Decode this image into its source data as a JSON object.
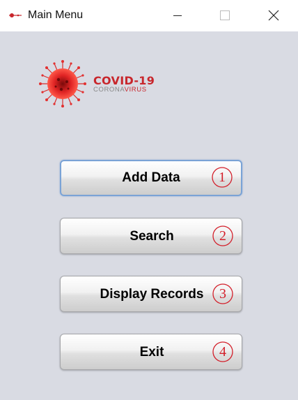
{
  "window": {
    "title": "Main Menu",
    "controls": {
      "minimize": "minimize-icon",
      "maximize": "maximize-icon",
      "close": "close-icon"
    }
  },
  "logo": {
    "title": "COVID-19",
    "subtitle_part1": "CORONA",
    "subtitle_part2": "VIRUS",
    "icon": "coronavirus-icon"
  },
  "menu": {
    "buttons": [
      {
        "label": "Add Data",
        "number": "1"
      },
      {
        "label": "Search",
        "number": "2"
      },
      {
        "label": "Display Records",
        "number": "3"
      },
      {
        "label": "Exit",
        "number": "4"
      }
    ]
  },
  "colors": {
    "accent_red": "#d31f2a",
    "background": "#d9dbe3",
    "focus_border": "#7aa3d6"
  }
}
